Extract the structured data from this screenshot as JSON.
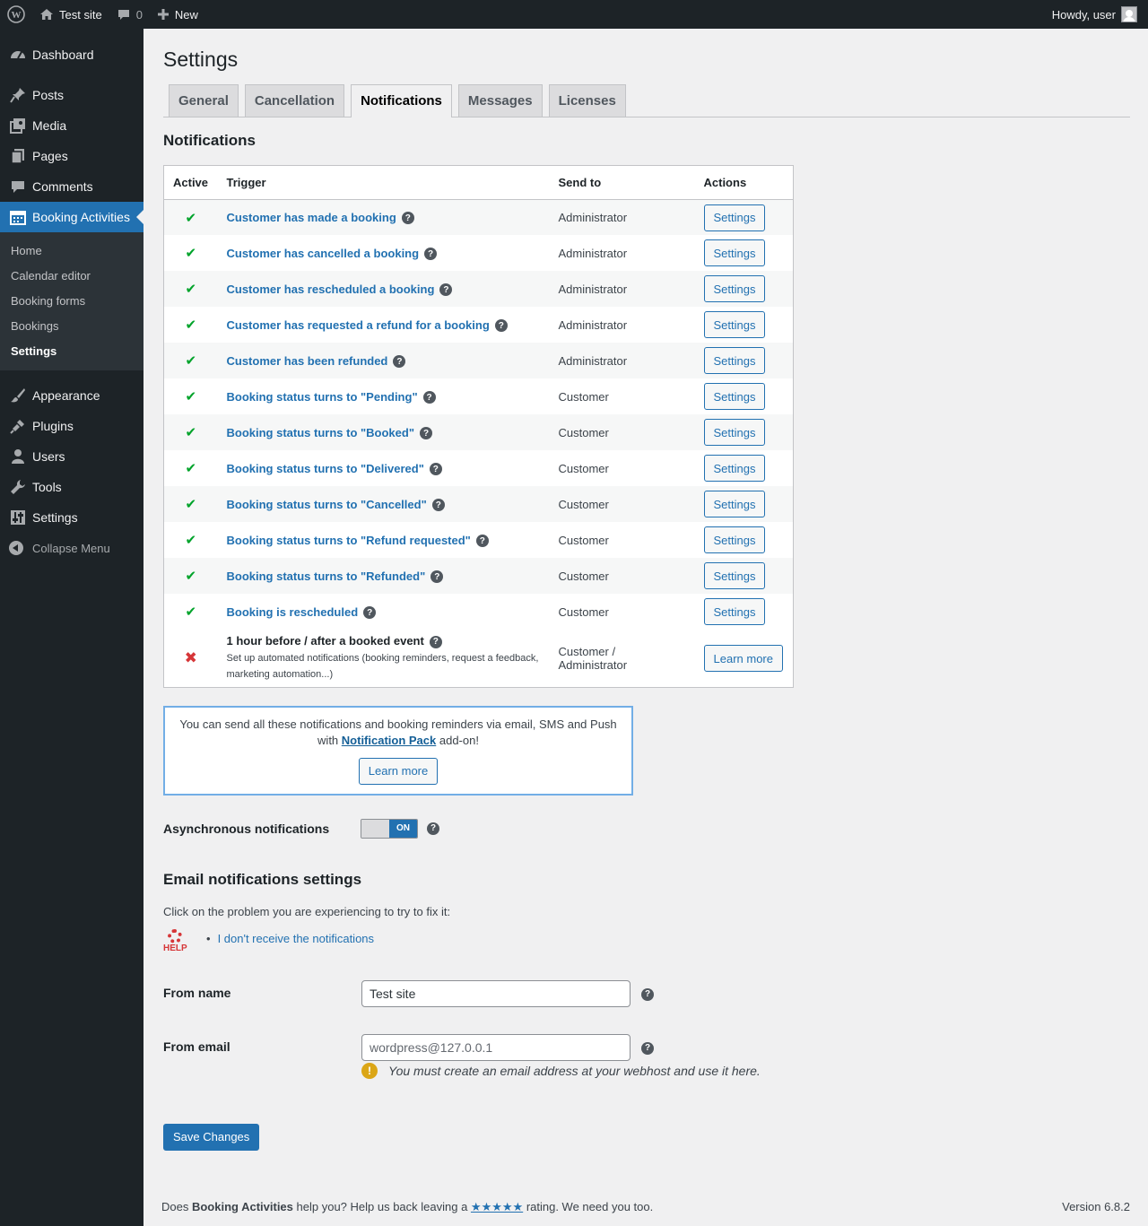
{
  "adminbar": {
    "site_name": "Test site",
    "comments_count": "0",
    "new_label": "New",
    "howdy": "Howdy, user"
  },
  "sidebar": {
    "items_top": [
      {
        "label": "Dashboard",
        "icon": "dashboard-icon"
      }
    ],
    "items_mid": [
      {
        "label": "Posts",
        "icon": "pin-icon"
      },
      {
        "label": "Media",
        "icon": "media-icon"
      },
      {
        "label": "Pages",
        "icon": "pages-icon"
      },
      {
        "label": "Comments",
        "icon": "comment-icon"
      }
    ],
    "current": {
      "label": "Booking Activities",
      "icon": "calendar-icon"
    },
    "submenu": [
      "Home",
      "Calendar editor",
      "Booking forms",
      "Bookings",
      "Settings"
    ],
    "items_bottom": [
      {
        "label": "Appearance",
        "icon": "brush-icon"
      },
      {
        "label": "Plugins",
        "icon": "plug-icon"
      },
      {
        "label": "Users",
        "icon": "user-icon"
      },
      {
        "label": "Tools",
        "icon": "wrench-icon"
      },
      {
        "label": "Settings",
        "icon": "settings-icon"
      }
    ],
    "collapse": "Collapse Menu"
  },
  "page": {
    "title": "Settings",
    "tabs": [
      "General",
      "Cancellation",
      "Notifications",
      "Messages",
      "Licenses"
    ],
    "active_tab": "Notifications"
  },
  "notifications": {
    "heading": "Notifications",
    "columns": [
      "Active",
      "Trigger",
      "Send to",
      "Actions"
    ],
    "rows": [
      {
        "active": true,
        "trigger": "Customer has made a booking",
        "send_to": "Administrator",
        "action": "Settings"
      },
      {
        "active": true,
        "trigger": "Customer has cancelled a booking",
        "send_to": "Administrator",
        "action": "Settings"
      },
      {
        "active": true,
        "trigger": "Customer has rescheduled a booking",
        "send_to": "Administrator",
        "action": "Settings"
      },
      {
        "active": true,
        "trigger": "Customer has requested a refund for a booking",
        "send_to": "Administrator",
        "action": "Settings"
      },
      {
        "active": true,
        "trigger": "Customer has been refunded",
        "send_to": "Administrator",
        "action": "Settings"
      },
      {
        "active": true,
        "trigger": "Booking status turns to \"Pending\"",
        "send_to": "Customer",
        "action": "Settings"
      },
      {
        "active": true,
        "trigger": "Booking status turns to \"Booked\"",
        "send_to": "Customer",
        "action": "Settings"
      },
      {
        "active": true,
        "trigger": "Booking status turns to \"Delivered\"",
        "send_to": "Customer",
        "action": "Settings"
      },
      {
        "active": true,
        "trigger": "Booking status turns to \"Cancelled\"",
        "send_to": "Customer",
        "action": "Settings"
      },
      {
        "active": true,
        "trigger": "Booking status turns to \"Refund requested\"",
        "send_to": "Customer",
        "action": "Settings"
      },
      {
        "active": true,
        "trigger": "Booking status turns to \"Refunded\"",
        "send_to": "Customer",
        "action": "Settings"
      },
      {
        "active": true,
        "trigger": "Booking is rescheduled",
        "send_to": "Customer",
        "action": "Settings"
      }
    ],
    "last_row": {
      "trigger": "1 hour before / after a booked event",
      "description": "Set up automated notifications (booking reminders, request a feedback, marketing automation...)",
      "send_to": "Customer / Administrator",
      "action": "Learn more"
    },
    "check_glyph": "✔",
    "cross_glyph": "✖"
  },
  "notice": {
    "text_before": "You can send all these notifications and booking reminders via email, SMS and Push with ",
    "link": "Notification Pack",
    "text_after": " add-on!",
    "button": "Learn more"
  },
  "async": {
    "label": "Asynchronous notifications",
    "toggle_on": "ON"
  },
  "email": {
    "heading": "Email notifications settings",
    "intro": "Click on the problem you are experiencing to try to fix it:",
    "help_label": "HELP",
    "problem_link": "I don't receive the notifications",
    "from_name_label": "From name",
    "from_name_value": "Test site",
    "from_email_label": "From email",
    "from_email_placeholder": "wordpress@127.0.0.1",
    "warning": "You must create an email address at your webhost and use it here."
  },
  "save_button": "Save Changes",
  "footer": {
    "text1": "Does ",
    "plugin": "Booking Activities",
    "text2": " help you? Help us back leaving a ",
    "stars": "★★★★★",
    "text3": " rating. We need you too.",
    "version": "Version 6.8.2"
  },
  "colors": {
    "admin_bar": "#1d2327",
    "accent": "#2271b1",
    "check": "#00a32a",
    "cross": "#d63638",
    "warning": "#dba617"
  }
}
